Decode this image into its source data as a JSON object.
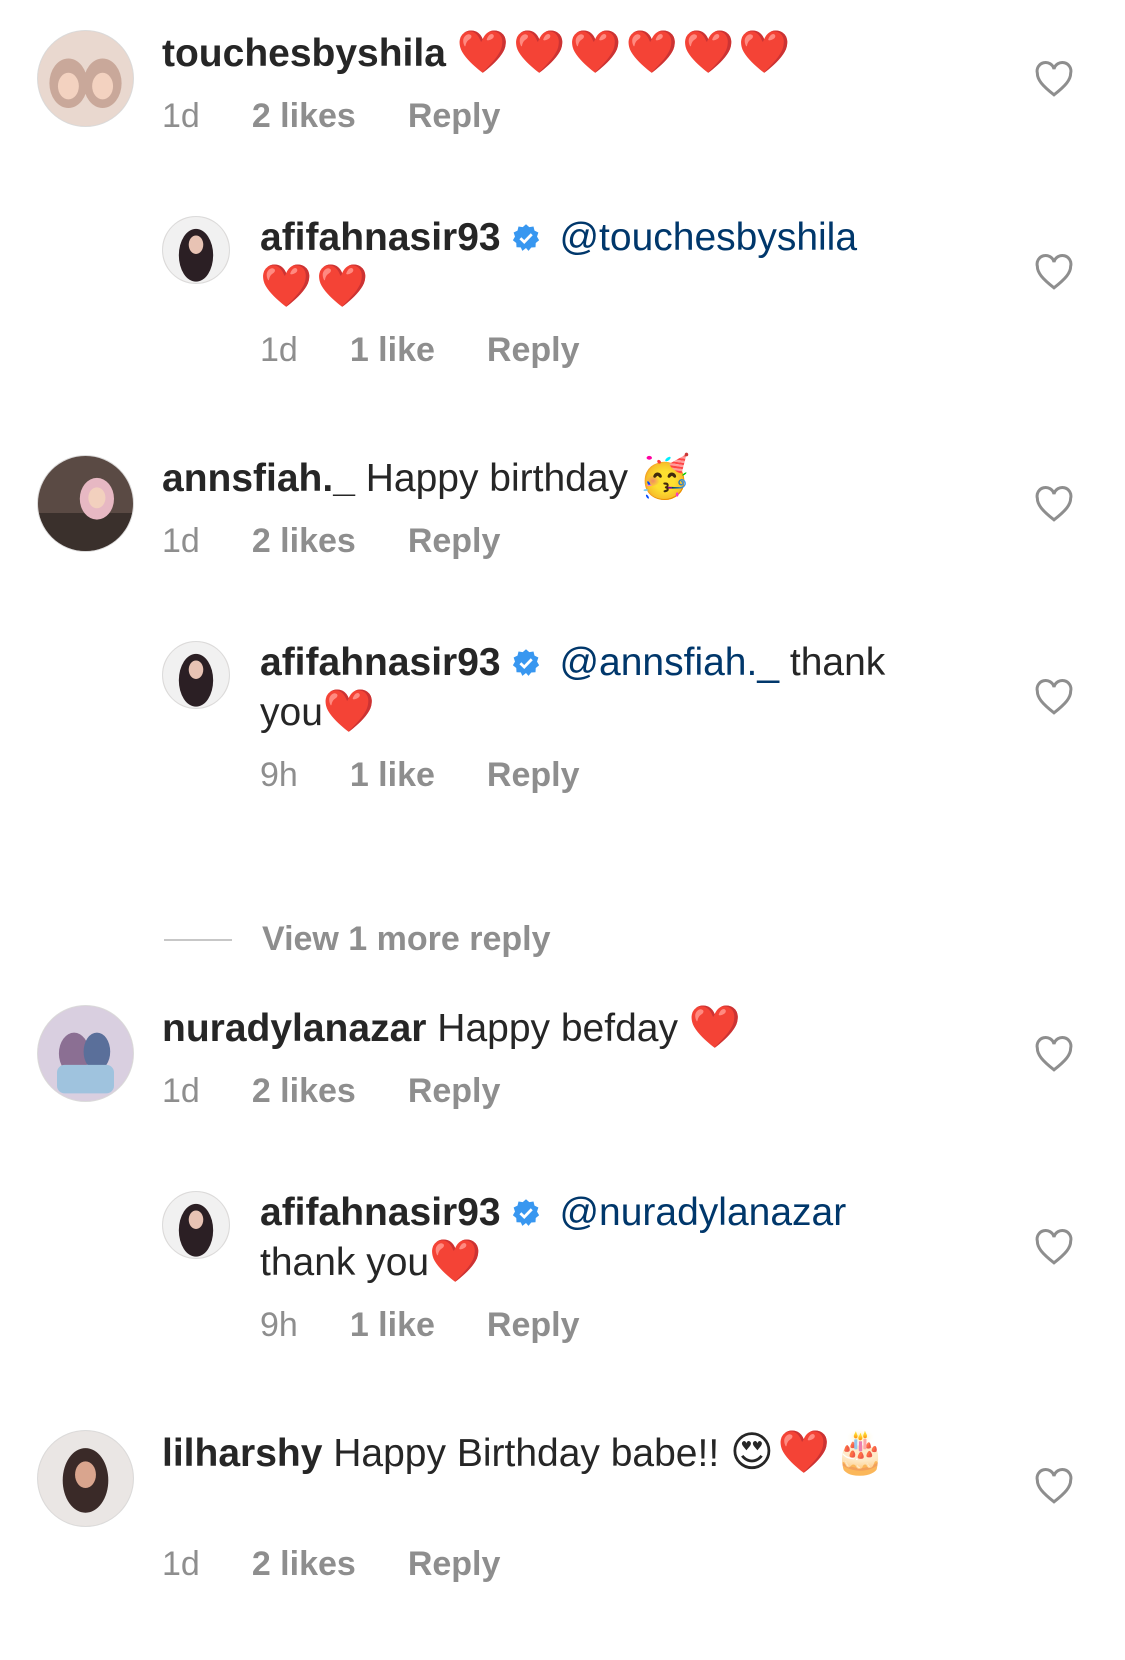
{
  "comments": [
    {
      "username": "touchesbyshila",
      "text": "",
      "emoji": "❤️❤️❤️❤️❤️❤️",
      "time": "1d",
      "likes": "2 likes",
      "reply": "Reply"
    },
    {
      "username": "afifahnasir93",
      "mention": "@touchesbyshila",
      "text": "",
      "emoji": "❤️❤️",
      "time": "1d",
      "likes": "1 like",
      "reply": "Reply"
    },
    {
      "username": "annsfiah._",
      "text": "Happy birthday",
      "emoji": "🥳",
      "time": "1d",
      "likes": "2 likes",
      "reply": "Reply"
    },
    {
      "username": "afifahnasir93",
      "mention": "@annsfiah._",
      "text": "thank you",
      "emoji": "❤️",
      "time": "9h",
      "likes": "1 like",
      "reply": "Reply"
    },
    {
      "username": "nuradylanazar",
      "text": "Happy befday",
      "emoji": "❤️",
      "time": "1d",
      "likes": "2 likes",
      "reply": "Reply"
    },
    {
      "username": "afifahnasir93",
      "mention": "@nuradylanazar",
      "text": "thank you",
      "emoji": "❤️",
      "time": "9h",
      "likes": "1 like",
      "reply": "Reply"
    },
    {
      "username": "lilharshy",
      "text": "Happy Birthday babe!!",
      "emoji": "😍❤️🎂",
      "time": "1d",
      "likes": "2 likes",
      "reply": "Reply"
    }
  ],
  "view_more": "View 1 more reply",
  "colors": {
    "mention": "#00376b",
    "meta": "#8e8e8e",
    "verified": "#3897f0"
  },
  "icons": {
    "like": "heart-outline-icon",
    "verified": "verified-badge-icon"
  }
}
